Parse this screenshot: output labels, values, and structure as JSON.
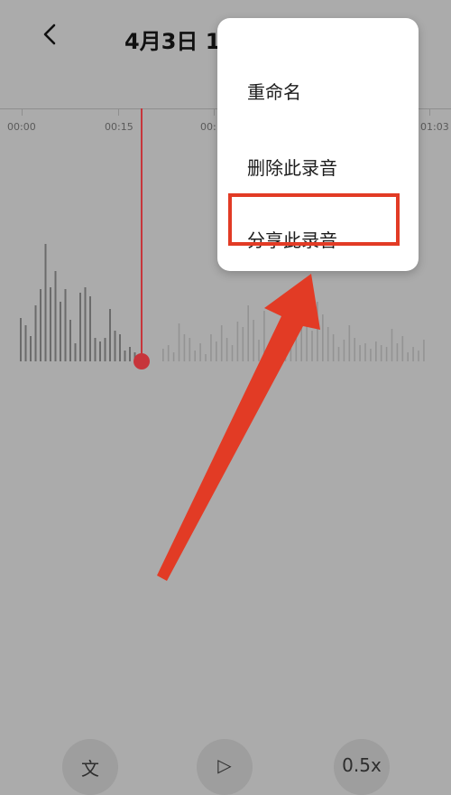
{
  "header": {
    "back_label": "<",
    "title": "4月3日 1"
  },
  "timeline": {
    "ticks": [
      "00:00",
      "00:15",
      "00:",
      "01:03"
    ]
  },
  "menu": {
    "items": [
      "重命名",
      "删除此录音",
      "分享此录音"
    ]
  },
  "controls": {
    "transcribe_label": "文",
    "play_label": "▷",
    "speed_label": "0.5x"
  },
  "colors": {
    "accent": "#c7353b",
    "arrow": "#e23b25",
    "background": "#ababab"
  }
}
